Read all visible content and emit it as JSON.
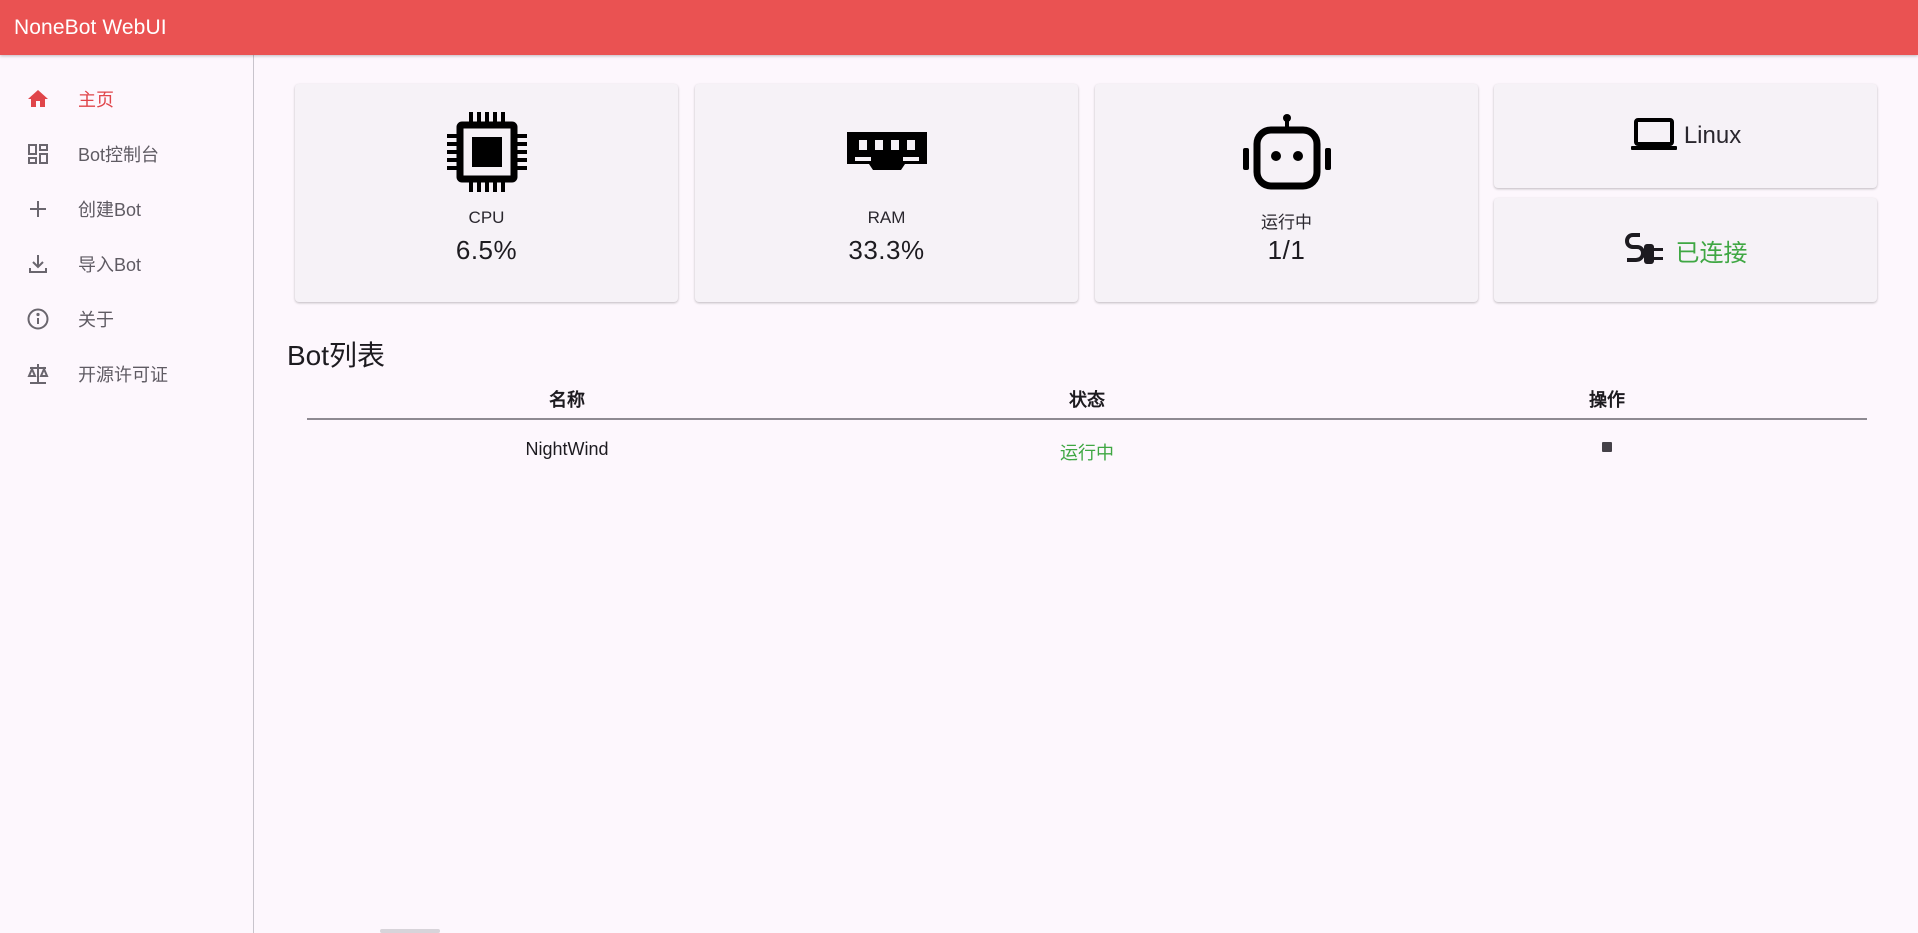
{
  "app": {
    "title": "NoneBot WebUI"
  },
  "colors": {
    "accent": "#ea5252",
    "active_nav": "#e0454a",
    "success": "#3fa743",
    "background": "#fdf7fd",
    "card": "#f6f2f7"
  },
  "sidebar": {
    "items": [
      {
        "label": "主页",
        "icon": "home-icon",
        "active": true
      },
      {
        "label": "Bot控制台",
        "icon": "dashboard-icon",
        "active": false
      },
      {
        "label": "创建Bot",
        "icon": "plus-icon",
        "active": false
      },
      {
        "label": "导入Bot",
        "icon": "download-icon",
        "active": false
      },
      {
        "label": "关于",
        "icon": "info-icon",
        "active": false
      },
      {
        "label": "开源许可证",
        "icon": "scale-icon",
        "active": false
      }
    ]
  },
  "stats": {
    "cpu": {
      "label": "CPU",
      "value": "6.5%",
      "icon": "cpu-chip-icon"
    },
    "ram": {
      "label": "RAM",
      "value": "33.3%",
      "icon": "memory-icon"
    },
    "running": {
      "label": "运行中",
      "value": "1/1",
      "icon": "robot-icon"
    },
    "os": {
      "label": "Linux",
      "icon": "laptop-icon"
    },
    "connection": {
      "label": "已连接",
      "icon": "plug-icon"
    }
  },
  "bot_list": {
    "title": "Bot列表",
    "columns": [
      "名称",
      "状态",
      "操作"
    ],
    "rows": [
      {
        "name": "NightWind",
        "status": "运行中",
        "action_icon": "stop-icon"
      }
    ]
  }
}
